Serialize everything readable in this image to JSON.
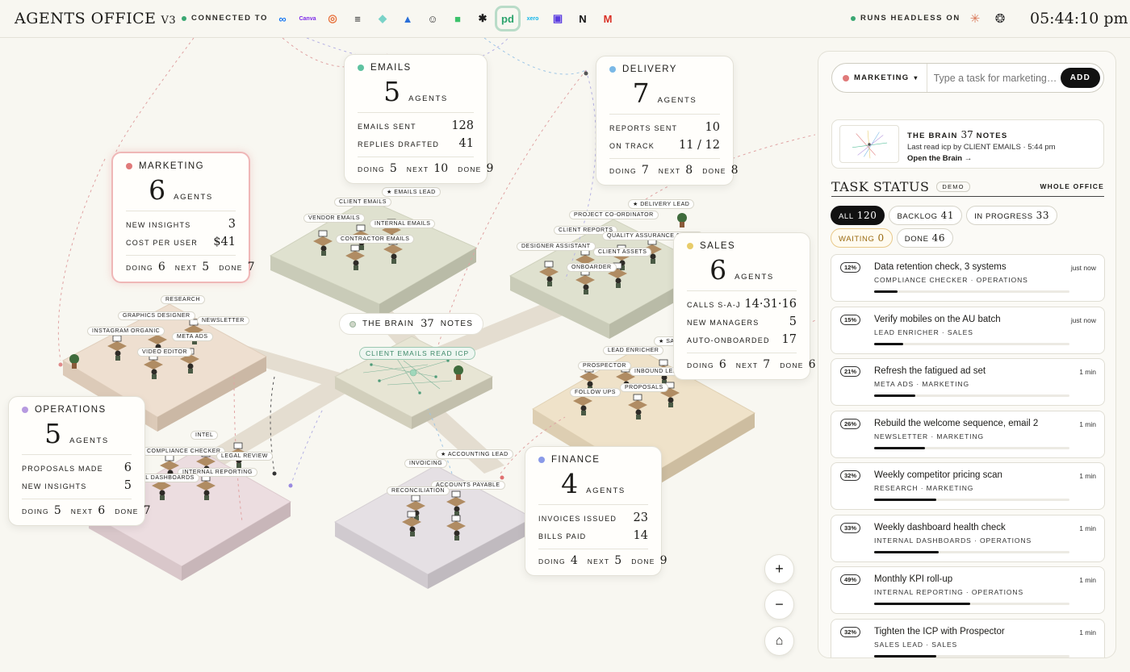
{
  "app": {
    "title": "AGENTS OFFICE",
    "version": "V3",
    "connected_label": "CONNECTED TO",
    "headless_label": "RUNS HEADLESS ON",
    "clock": "05:44:10 pm"
  },
  "integrations": [
    {
      "name": "meta",
      "glyph": "∞",
      "color": "#1877f2"
    },
    {
      "name": "canva",
      "glyph": "Canva",
      "color": "#7d2ae8"
    },
    {
      "name": "ring",
      "glyph": "◎",
      "color": "#e8703a"
    },
    {
      "name": "stack",
      "glyph": "≡",
      "color": "#222222"
    },
    {
      "name": "gem",
      "glyph": "◆",
      "color": "#7ad3c8"
    },
    {
      "name": "drive",
      "glyph": "▲",
      "color": "#2a6fd9"
    },
    {
      "name": "smile",
      "glyph": "☺",
      "color": "#333333"
    },
    {
      "name": "chat",
      "glyph": "■",
      "color": "#3cc26b"
    },
    {
      "name": "perplexity",
      "glyph": "✱",
      "color": "#1f1f1f"
    },
    {
      "name": "pd",
      "glyph": "pd",
      "color": "#2aa36b"
    },
    {
      "name": "xero",
      "glyph": "xero",
      "color": "#13b5ea"
    },
    {
      "name": "square",
      "glyph": "▣",
      "color": "#5b3de0"
    },
    {
      "name": "notion",
      "glyph": "N",
      "color": "#111111"
    },
    {
      "name": "gmail",
      "glyph": "M",
      "color": "#d93025"
    }
  ],
  "headless": [
    {
      "name": "claude",
      "glyph": "✳",
      "color": "#d97757"
    },
    {
      "name": "openai",
      "glyph": "❂",
      "color": "#333333"
    }
  ],
  "teams": {
    "emails": {
      "name": "EMAILS",
      "count": "5",
      "agents_label": "AGENTS",
      "color": "#5ec2a0",
      "stats": [
        {
          "label": "EMAILS SENT",
          "value": "128"
        },
        {
          "label": "REPLIES DRAFTED",
          "value": "41"
        }
      ],
      "doing": "5",
      "next": "10",
      "done": "9"
    },
    "delivery": {
      "name": "DELIVERY",
      "count": "7",
      "agents_label": "AGENTS",
      "color": "#7ab8e6",
      "stats": [
        {
          "label": "REPORTS SENT",
          "value": "10"
        },
        {
          "label": "ON TRACK",
          "value": "11 / 12"
        }
      ],
      "doing": "7",
      "next": "8",
      "done": "8"
    },
    "marketing": {
      "name": "MARKETING",
      "count": "6",
      "agents_label": "AGENTS",
      "color": "#e07a7a",
      "stats": [
        {
          "label": "NEW INSIGHTS",
          "value": "3"
        },
        {
          "label": "COST PER USER",
          "value": "$41"
        }
      ],
      "doing": "6",
      "next": "5",
      "done": "7"
    },
    "sales": {
      "name": "SALES",
      "count": "6",
      "agents_label": "AGENTS",
      "color": "#e8cc6a",
      "stats": [
        {
          "label": "CALLS S-A-J",
          "value": "14·31·16"
        },
        {
          "label": "NEW MANAGERS",
          "value": "5"
        },
        {
          "label": "AUTO-ONBOARDED",
          "value": "17"
        }
      ],
      "doing": "6",
      "next": "7",
      "done": "6"
    },
    "operations": {
      "name": "OPERATIONS",
      "count": "5",
      "agents_label": "AGENTS",
      "color": "#b79ae0",
      "stats": [
        {
          "label": "PROPOSALS MADE",
          "value": "6"
        },
        {
          "label": "NEW INSIGHTS",
          "value": "5"
        }
      ],
      "doing": "5",
      "next": "6",
      "done": "7"
    },
    "finance": {
      "name": "FINANCE",
      "count": "4",
      "agents_label": "AGENTS",
      "color": "#8a9ae8",
      "stats": [
        {
          "label": "INVOICES ISSUED",
          "value": "23"
        },
        {
          "label": "BILLS PAID",
          "value": "14"
        }
      ],
      "doing": "4",
      "next": "5",
      "done": "9"
    }
  },
  "labels": {
    "doing": "DOING",
    "next": "NEXT",
    "done": "DONE"
  },
  "brain": {
    "label": "THE BRAIN",
    "notes": "37",
    "notes_label": "NOTES",
    "read_badge": "CLIENT EMAILS READ ICP"
  },
  "agent_tags": [
    "★ EMAILS LEAD",
    "CLIENT EMAILS",
    "VENDOR EMAILS",
    "INTERNAL EMAILS",
    "CONTRACTOR EMAILS",
    "★ DELIVERY LEAD",
    "PROJECT CO-ORDINATOR",
    "CLIENT REPORTS",
    "QUALITY ASSURANCE CHECK",
    "DESIGNER ASSISTANT",
    "CLIENT ASSETS",
    "ONBOARDER",
    "RESEARCH",
    "GRAPHICS DESIGNER",
    "NEWSLETTER",
    "INSTAGRAM ORGANIC",
    "META ADS",
    "VIDEO EDITOR",
    "LEAD ENRICHER",
    "★ SA",
    "PROSPECTOR",
    "INBOUND LEADS",
    "FOLLOW UPS",
    "PROPOSALS",
    "INTEL",
    "COMPLIANCE CHECKER",
    "LEGAL REVIEW",
    "INTERNAL REPORTING",
    "INTERNAL DASHBOARDS",
    "★ ACCOUNTING LEAD",
    "INVOICING",
    "ACCOUNTS PAYABLE",
    "RECONCILIATION"
  ],
  "zoom": {
    "in": "+",
    "out": "−",
    "home": "⌂"
  },
  "panel": {
    "team_select": "MARKETING",
    "input_placeholder": "Type a task for marketing…",
    "add": "ADD",
    "brain_box": {
      "title": "THE BRAIN",
      "notes": "37",
      "notes_label": "NOTES",
      "last_read": "Last read icp by CLIENT EMAILS · 5:44 pm",
      "open": "Open the Brain →"
    },
    "task_status": {
      "title": "TASK STATUS",
      "demo": "DEMO",
      "scope": "WHOLE OFFICE"
    },
    "filters": [
      {
        "label": "ALL",
        "count": "120",
        "state": "on"
      },
      {
        "label": "BACKLOG",
        "count": "41",
        "state": ""
      },
      {
        "label": "IN PROGRESS",
        "count": "33",
        "state": ""
      },
      {
        "label": "WAITING",
        "count": "0",
        "state": "wait"
      },
      {
        "label": "DONE",
        "count": "46",
        "state": ""
      }
    ],
    "tasks": [
      {
        "pct": "12%",
        "progress": 0.12,
        "title": "Data retention check, 3 systems",
        "meta": "COMPLIANCE CHECKER · OPERATIONS",
        "time": "just now"
      },
      {
        "pct": "15%",
        "progress": 0.15,
        "title": "Verify mobiles on the AU batch",
        "meta": "LEAD ENRICHER · SALES",
        "time": "just now"
      },
      {
        "pct": "21%",
        "progress": 0.21,
        "title": "Refresh the fatigued ad set",
        "meta": "META ADS · MARKETING",
        "time": "1 min"
      },
      {
        "pct": "26%",
        "progress": 0.26,
        "title": "Rebuild the welcome sequence, email 2",
        "meta": "NEWSLETTER · MARKETING",
        "time": "1 min"
      },
      {
        "pct": "32%",
        "progress": 0.32,
        "title": "Weekly competitor pricing scan",
        "meta": "RESEARCH · MARKETING",
        "time": "1 min"
      },
      {
        "pct": "33%",
        "progress": 0.33,
        "title": "Weekly dashboard health check",
        "meta": "INTERNAL DASHBOARDS · OPERATIONS",
        "time": "1 min"
      },
      {
        "pct": "49%",
        "progress": 0.49,
        "title": "Monthly KPI roll-up",
        "meta": "INTERNAL REPORTING · OPERATIONS",
        "time": "1 min"
      },
      {
        "pct": "32%",
        "progress": 0.32,
        "title": "Tighten the ICP with Prospector",
        "meta": "SALES LEAD · SALES",
        "time": "1 min"
      }
    ]
  }
}
